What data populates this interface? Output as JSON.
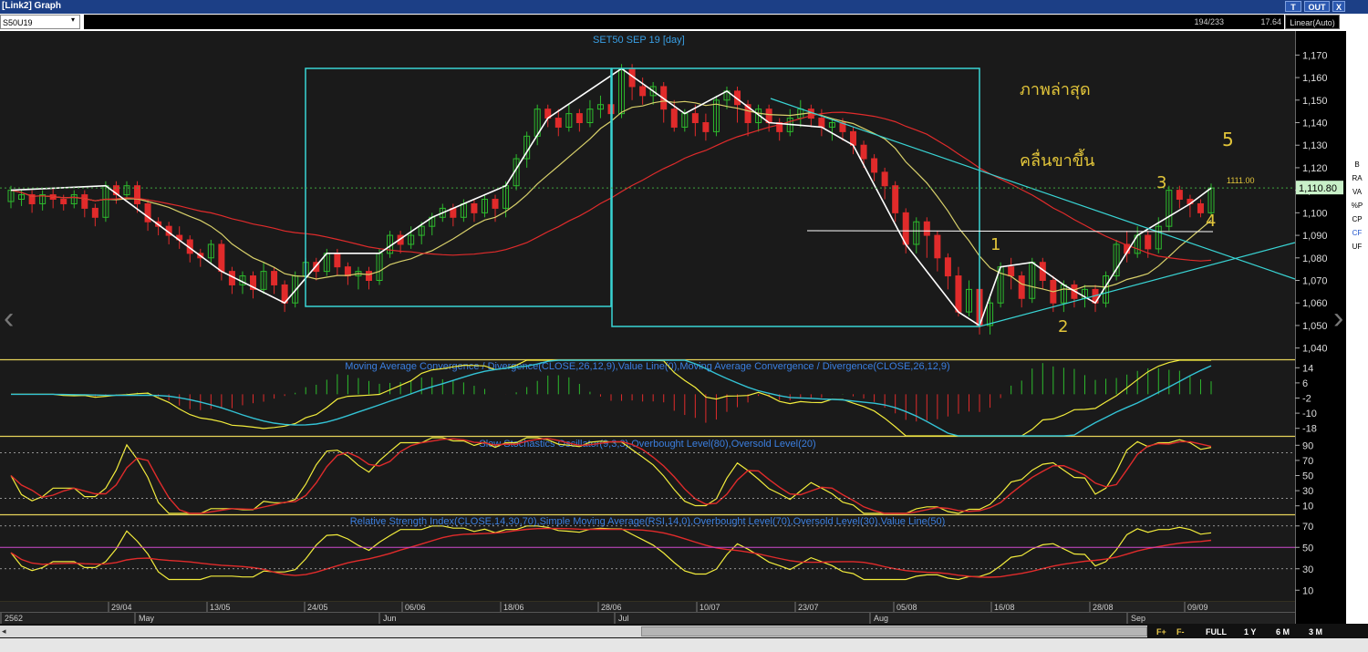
{
  "window": {
    "title": "[Link2] Graph",
    "out_label": "OUT",
    "close_label": "X",
    "t_label": "T"
  },
  "toolbar": {
    "symbol": "S50U19",
    "dropdown": "▾",
    "count": "194/233",
    "value": "17.64",
    "scale": "Linear(Auto)"
  },
  "sidebar": {
    "items": [
      "B",
      "RA",
      "VA",
      "%P",
      "CP",
      "CF",
      "UF"
    ]
  },
  "bottom": {
    "scroll_left": "◂",
    "fwd1": "F+",
    "fwd2": "F-",
    "ranges": [
      "FULL",
      "1 Y",
      "6 M",
      "3 M"
    ]
  },
  "chart_data": {
    "type": "candlestick",
    "title": "SET50 SEP 19  [day]",
    "price_axis": {
      "ticks": [
        "1,170",
        "1,160",
        "1,150",
        "1,140",
        "1,130",
        "1,120",
        "1,110",
        "1,100",
        "1,090",
        "1,080",
        "1,070",
        "1,060",
        "1,050",
        "1,040"
      ],
      "ylim": [
        1035,
        1175
      ]
    },
    "last_price_label": "1,110.80",
    "hline_label": "1111.00",
    "annotations": [
      "ภาพล่าสุด",
      "คลื่นขาขึ้น",
      "5",
      "3",
      "4",
      "1",
      "2"
    ],
    "dates": [
      "29/04",
      "13/05",
      "24/05",
      "06/06",
      "18/06",
      "28/06",
      "10/07",
      "23/07",
      "05/08",
      "16/08",
      "28/08",
      "09/09"
    ],
    "months": [
      "2562",
      "May",
      "Jun",
      "Jul",
      "Aug",
      "Sep"
    ],
    "candles": [
      [
        1105,
        1110,
        1102,
        1112
      ],
      [
        1106,
        1108,
        1103,
        1110
      ],
      [
        1108,
        1104,
        1100,
        1110
      ],
      [
        1104,
        1108,
        1101,
        1110
      ],
      [
        1108,
        1106,
        1102,
        1111
      ],
      [
        1106,
        1104,
        1101,
        1108
      ],
      [
        1104,
        1108,
        1102,
        1110
      ],
      [
        1108,
        1102,
        1098,
        1110
      ],
      [
        1102,
        1098,
        1094,
        1104
      ],
      [
        1098,
        1112,
        1096,
        1114
      ],
      [
        1112,
        1108,
        1104,
        1114
      ],
      [
        1108,
        1112,
        1106,
        1114
      ],
      [
        1112,
        1104,
        1100,
        1114
      ],
      [
        1104,
        1096,
        1092,
        1106
      ],
      [
        1096,
        1094,
        1090,
        1098
      ],
      [
        1094,
        1090,
        1086,
        1096
      ],
      [
        1090,
        1088,
        1084,
        1094
      ],
      [
        1088,
        1082,
        1078,
        1090
      ],
      [
        1082,
        1080,
        1076,
        1084
      ],
      [
        1080,
        1086,
        1077,
        1088
      ],
      [
        1086,
        1074,
        1070,
        1088
      ],
      [
        1074,
        1068,
        1064,
        1076
      ],
      [
        1068,
        1072,
        1064,
        1074
      ],
      [
        1072,
        1066,
        1062,
        1074
      ],
      [
        1066,
        1074,
        1064,
        1078
      ],
      [
        1074,
        1068,
        1064,
        1076
      ],
      [
        1068,
        1060,
        1056,
        1070
      ],
      [
        1060,
        1072,
        1058,
        1074
      ],
      [
        1072,
        1078,
        1068,
        1080
      ],
      [
        1078,
        1074,
        1070,
        1080
      ],
      [
        1074,
        1082,
        1072,
        1084
      ],
      [
        1082,
        1076,
        1072,
        1084
      ],
      [
        1076,
        1072,
        1068,
        1078
      ],
      [
        1072,
        1074,
        1066,
        1076
      ],
      [
        1074,
        1070,
        1066,
        1076
      ],
      [
        1070,
        1082,
        1068,
        1084
      ],
      [
        1082,
        1090,
        1080,
        1092
      ],
      [
        1090,
        1086,
        1082,
        1092
      ],
      [
        1086,
        1090,
        1084,
        1094
      ],
      [
        1090,
        1094,
        1086,
        1096
      ],
      [
        1094,
        1098,
        1090,
        1100
      ],
      [
        1098,
        1102,
        1096,
        1104
      ],
      [
        1102,
        1098,
        1094,
        1104
      ],
      [
        1098,
        1104,
        1096,
        1106
      ],
      [
        1104,
        1100,
        1096,
        1106
      ],
      [
        1100,
        1106,
        1098,
        1108
      ],
      [
        1106,
        1102,
        1096,
        1108
      ],
      [
        1102,
        1112,
        1098,
        1114
      ],
      [
        1112,
        1124,
        1110,
        1126
      ],
      [
        1124,
        1134,
        1120,
        1136
      ],
      [
        1134,
        1146,
        1130,
        1148
      ],
      [
        1146,
        1142,
        1138,
        1148
      ],
      [
        1142,
        1138,
        1134,
        1146
      ],
      [
        1138,
        1144,
        1136,
        1148
      ],
      [
        1144,
        1140,
        1136,
        1146
      ],
      [
        1140,
        1146,
        1138,
        1150
      ],
      [
        1146,
        1148,
        1142,
        1152
      ],
      [
        1148,
        1144,
        1140,
        1150
      ],
      [
        1144,
        1164,
        1142,
        1166
      ],
      [
        1164,
        1156,
        1150,
        1166
      ],
      [
        1156,
        1152,
        1148,
        1160
      ],
      [
        1152,
        1156,
        1148,
        1158
      ],
      [
        1156,
        1146,
        1140,
        1158
      ],
      [
        1146,
        1138,
        1136,
        1150
      ],
      [
        1138,
        1144,
        1136,
        1146
      ],
      [
        1144,
        1140,
        1134,
        1148
      ],
      [
        1140,
        1136,
        1132,
        1144
      ],
      [
        1136,
        1150,
        1134,
        1152
      ],
      [
        1150,
        1154,
        1146,
        1156
      ],
      [
        1154,
        1148,
        1140,
        1156
      ],
      [
        1148,
        1140,
        1134,
        1150
      ],
      [
        1140,
        1146,
        1136,
        1148
      ],
      [
        1146,
        1140,
        1136,
        1148
      ],
      [
        1140,
        1136,
        1132,
        1142
      ],
      [
        1136,
        1142,
        1134,
        1146
      ],
      [
        1142,
        1146,
        1138,
        1150
      ],
      [
        1146,
        1142,
        1138,
        1148
      ],
      [
        1142,
        1138,
        1134,
        1146
      ],
      [
        1138,
        1140,
        1132,
        1142
      ],
      [
        1140,
        1136,
        1132,
        1142
      ],
      [
        1136,
        1130,
        1126,
        1138
      ],
      [
        1130,
        1124,
        1120,
        1132
      ],
      [
        1124,
        1118,
        1114,
        1126
      ],
      [
        1118,
        1112,
        1106,
        1120
      ],
      [
        1112,
        1100,
        1096,
        1114
      ],
      [
        1100,
        1086,
        1082,
        1102
      ],
      [
        1086,
        1096,
        1082,
        1098
      ],
      [
        1096,
        1090,
        1080,
        1098
      ],
      [
        1090,
        1080,
        1074,
        1092
      ],
      [
        1080,
        1072,
        1066,
        1082
      ],
      [
        1072,
        1056,
        1054,
        1076
      ],
      [
        1056,
        1066,
        1054,
        1070
      ],
      [
        1066,
        1050,
        1046,
        1068
      ],
      [
        1050,
        1060,
        1046,
        1064
      ],
      [
        1060,
        1076,
        1058,
        1078
      ],
      [
        1076,
        1072,
        1066,
        1080
      ],
      [
        1072,
        1062,
        1058,
        1074
      ],
      [
        1062,
        1078,
        1060,
        1080
      ],
      [
        1078,
        1070,
        1066,
        1080
      ],
      [
        1070,
        1060,
        1056,
        1072
      ],
      [
        1060,
        1068,
        1056,
        1070
      ],
      [
        1068,
        1062,
        1058,
        1070
      ],
      [
        1062,
        1066,
        1058,
        1068
      ],
      [
        1066,
        1060,
        1056,
        1068
      ],
      [
        1060,
        1072,
        1058,
        1074
      ],
      [
        1072,
        1086,
        1070,
        1088
      ],
      [
        1086,
        1082,
        1078,
        1092
      ],
      [
        1082,
        1090,
        1080,
        1094
      ],
      [
        1090,
        1084,
        1080,
        1092
      ],
      [
        1084,
        1094,
        1082,
        1098
      ],
      [
        1094,
        1110,
        1092,
        1112
      ],
      [
        1110,
        1106,
        1102,
        1112
      ],
      [
        1106,
        1104,
        1098,
        1108
      ],
      [
        1104,
        1100,
        1098,
        1106
      ],
      [
        1100,
        1111,
        1098,
        1113
      ]
    ],
    "indicators": [
      {
        "name": "Moving Average Convergence / Divergence(CLOSE,26,12,9),Value Line(0),Moving Average Convergence / Divergence(CLOSE,26,12,9)",
        "ticks": [
          "14",
          "6",
          "-2",
          "-10",
          "-18"
        ],
        "ylim": [
          -22,
          18
        ]
      },
      {
        "name": "Slow Stochastics Oscillator(9,3,3),Overbought Level(80),Oversold Level(20)",
        "ticks": [
          "90",
          "70",
          "50",
          "30",
          "10"
        ],
        "ylim": [
          0,
          100
        ]
      },
      {
        "name": "Relative Strength Index(CLOSE,14,30,70),Simple Moving Average(RSI,14,0),Overbought Level(70),Oversold Level(30),Value Line(50)",
        "ticks": [
          "70",
          "50",
          "30",
          "10"
        ],
        "ylim": [
          0,
          80
        ]
      }
    ]
  },
  "colors": {
    "up": "#2dbb2d",
    "down": "#e02b2b",
    "box": "#39d4d4",
    "sma_fast": "#d8d06a",
    "sma_slow": "#e02b2b",
    "label": "#e2c53a"
  }
}
